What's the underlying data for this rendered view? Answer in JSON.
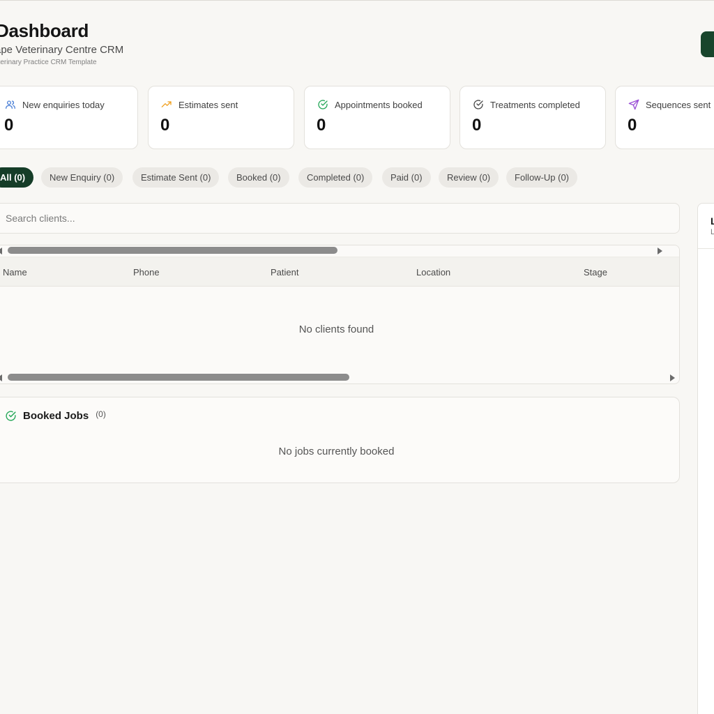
{
  "header": {
    "title": "Dashboard",
    "subtitle": "ape Veterinary Centre CRM",
    "template_note": "eterinary Practice CRM Template",
    "accent": "#18452c"
  },
  "stats": [
    {
      "label": "New enquiries today",
      "value": "0",
      "icon": "users-icon",
      "color": "#4a7fd6"
    },
    {
      "label": "Estimates sent",
      "value": "0",
      "icon": "trending-up-icon",
      "color": "#f0a020"
    },
    {
      "label": "Appointments booked",
      "value": "0",
      "icon": "check-circle-icon",
      "color": "#27a85a"
    },
    {
      "label": "Treatments completed",
      "value": "0",
      "icon": "check-circle-icon",
      "color": "#4a4a4a"
    },
    {
      "label": "Sequences sent",
      "value": "0",
      "icon": "send-icon",
      "color": "#9b4fd6"
    }
  ],
  "filters": [
    {
      "label": "All (0)",
      "active": true
    },
    {
      "label": "New Enquiry (0)",
      "active": false
    },
    {
      "label": "Estimate Sent (0)",
      "active": false
    },
    {
      "label": "Booked (0)",
      "active": false
    },
    {
      "label": "Completed (0)",
      "active": false
    },
    {
      "label": "Paid (0)",
      "active": false
    },
    {
      "label": "Review (0)",
      "active": false
    },
    {
      "label": "Follow-Up (0)",
      "active": false
    }
  ],
  "search": {
    "placeholder": "Search clients..."
  },
  "table": {
    "columns": [
      "Name",
      "Phone",
      "Patient",
      "Location",
      "Stage"
    ],
    "empty_message": "No clients found"
  },
  "booked_jobs": {
    "title": "Booked Jobs",
    "count": "(0)",
    "empty_message": "No jobs currently booked"
  },
  "side_panel": {
    "title": "L",
    "subtitle": "L"
  }
}
